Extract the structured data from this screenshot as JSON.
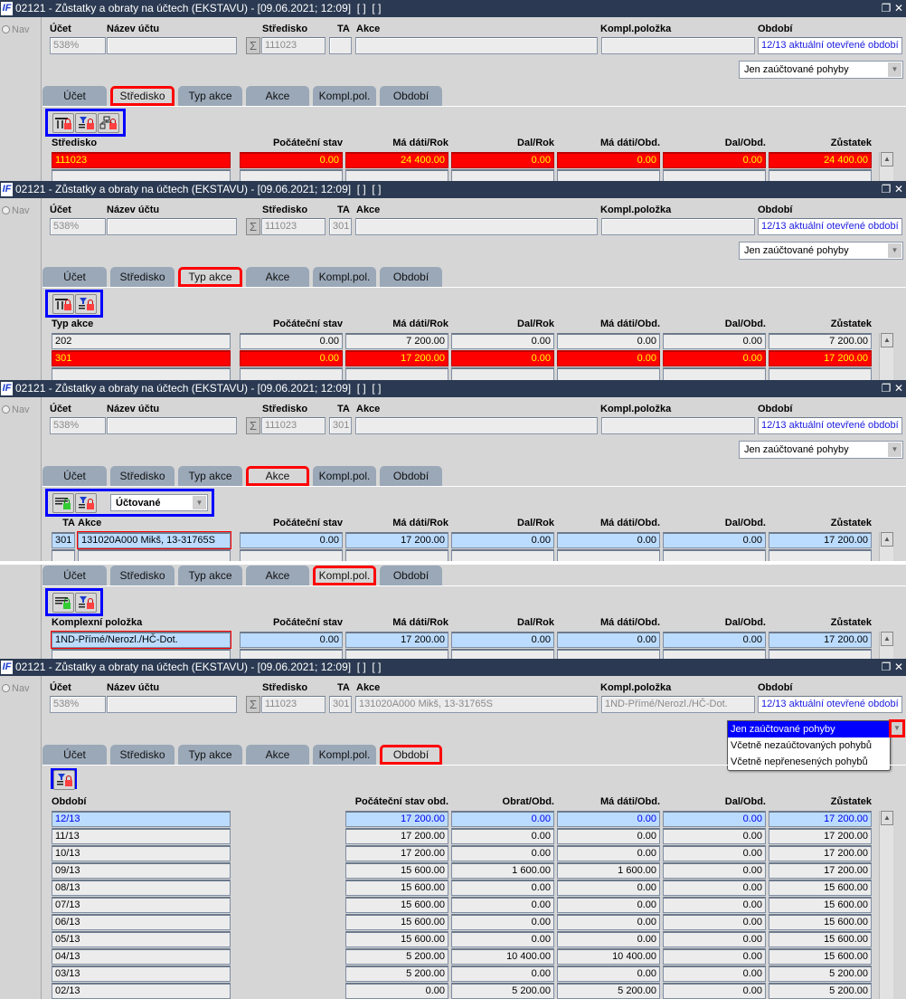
{
  "window": {
    "title": "02121 - Zůstatky a obraty na účtech (EKSTAVU) - [09.06.2021; 12:09]  [ ]  [ ]",
    "nav_label": "Nav",
    "logo": "IF"
  },
  "labels": {
    "ucet": "Účet",
    "nazev": "Název účtu",
    "stredisko": "Středisko",
    "ta": "TA",
    "akce": "Akce",
    "kompl": "Kompl.položka",
    "obdobi": "Období",
    "sigma": "Σ"
  },
  "tabs": [
    "Účet",
    "Středisko",
    "Typ akce",
    "Akce",
    "Kompl.pol.",
    "Období"
  ],
  "filter_options": [
    "Jen zaúčtované pohyby",
    "Včetně nezaúčtovaných pohybů",
    "Včetně nepřenesených pohybů"
  ],
  "colors": {
    "titlebar": "#2b3a52",
    "highlight_red": "#ff0000",
    "toolbar_outline": "#0000ff",
    "selected_row": "#bcdcff"
  },
  "panels": [
    {
      "header": {
        "ucet": "538%",
        "nazev": "",
        "stredisko": "111023",
        "ta": "",
        "akce": "",
        "kompl": "",
        "obdobi": "12/13 aktuální otevřené období"
      },
      "filter": "Jen zaúčtované pohyby",
      "active_tab": 1,
      "toolbar": [
        "columns-lock-icon",
        "filter-lock-icon",
        "hierarchy-lock-icon"
      ],
      "columns": [
        "Středisko",
        "Počáteční stav",
        "Má dáti/Rok",
        "Dal/Rok",
        "Má dáti/Obd.",
        "Dal/Obd.",
        "Zůstatek"
      ],
      "rows": [
        [
          "111023",
          "0.00",
          "24 400.00",
          "0.00",
          "0.00",
          "0.00",
          "24 400.00"
        ]
      ],
      "row_style": "red"
    },
    {
      "header": {
        "ucet": "538%",
        "nazev": "",
        "stredisko": "111023",
        "ta": "301",
        "akce": "",
        "kompl": "",
        "obdobi": "12/13 aktuální otevřené období"
      },
      "filter": "Jen zaúčtované pohyby",
      "active_tab": 2,
      "toolbar": [
        "columns-lock-icon",
        "filter-lock-icon"
      ],
      "columns": [
        "Typ akce",
        "Počáteční stav",
        "Má dáti/Rok",
        "Dal/Rok",
        "Má dáti/Obd.",
        "Dal/Obd.",
        "Zůstatek"
      ],
      "rows": [
        [
          "202",
          "0.00",
          "7 200.00",
          "0.00",
          "0.00",
          "0.00",
          "7 200.00"
        ],
        [
          "301",
          "0.00",
          "17 200.00",
          "0.00",
          "0.00",
          "0.00",
          "17 200.00"
        ]
      ],
      "selected_row": 1,
      "row_style": "red"
    },
    {
      "header": {
        "ucet": "538%",
        "nazev": "",
        "stredisko": "111023",
        "ta": "301",
        "akce": "",
        "kompl": "",
        "obdobi": "12/13 aktuální otevřené období"
      },
      "filter": "Jen zaúčtované pohyby",
      "active_tab": 3,
      "toolbar": [
        "columns-lock-green-icon",
        "filter-lock-icon"
      ],
      "toolbar_select": "Účtované",
      "columns": [
        "TA",
        "Akce",
        "Počáteční stav",
        "Má dáti/Rok",
        "Dal/Rok",
        "Má dáti/Obd.",
        "Dal/Obd.",
        "Zůstatek"
      ],
      "rows": [
        [
          "301",
          "131020A000 Mikš, 13-31765S",
          "0.00",
          "17 200.00",
          "0.00",
          "0.00",
          "0.00",
          "17 200.00"
        ]
      ],
      "row_style": "blue"
    },
    {
      "active_tab": 4,
      "toolbar": [
        "columns-lock-green-icon",
        "filter-lock-icon"
      ],
      "columns": [
        "Komplexní položka",
        "Počáteční stav",
        "Má dáti/Rok",
        "Dal/Rok",
        "Má dáti/Obd.",
        "Dal/Obd.",
        "Zůstatek"
      ],
      "rows": [
        [
          "1ND-Přímé/Nerozl./HČ-Dot.",
          "0.00",
          "17 200.00",
          "0.00",
          "0.00",
          "0.00",
          "17 200.00"
        ]
      ],
      "row_style": "blue"
    },
    {
      "header": {
        "ucet": "538%",
        "nazev": "",
        "stredisko": "111023",
        "ta": "301",
        "akce": "131020A000 Mikš, 13-31765S",
        "kompl": "1ND-Přímé/Nerozl./HČ-Dot.",
        "obdobi": "12/13 aktuální otevřené období"
      },
      "filter": "Jen zaúčtované pohyby",
      "filter_open": true,
      "active_tab": 5,
      "toolbar": [
        "filter-lock-icon"
      ],
      "columns": [
        "Období",
        "Počáteční stav obd.",
        "Obrat/Obd.",
        "Má dáti/Obd.",
        "Dal/Obd.",
        "Zůstatek"
      ],
      "rows": [
        [
          "12/13",
          "17 200.00",
          "0.00",
          "0.00",
          "0.00",
          "17 200.00"
        ],
        [
          "11/13",
          "17 200.00",
          "0.00",
          "0.00",
          "0.00",
          "17 200.00"
        ],
        [
          "10/13",
          "17 200.00",
          "0.00",
          "0.00",
          "0.00",
          "17 200.00"
        ],
        [
          "09/13",
          "15 600.00",
          "1 600.00",
          "1 600.00",
          "0.00",
          "17 200.00"
        ],
        [
          "08/13",
          "15 600.00",
          "0.00",
          "0.00",
          "0.00",
          "15 600.00"
        ],
        [
          "07/13",
          "15 600.00",
          "0.00",
          "0.00",
          "0.00",
          "15 600.00"
        ],
        [
          "06/13",
          "15 600.00",
          "0.00",
          "0.00",
          "0.00",
          "15 600.00"
        ],
        [
          "05/13",
          "15 600.00",
          "0.00",
          "0.00",
          "0.00",
          "15 600.00"
        ],
        [
          "04/13",
          "5 200.00",
          "10 400.00",
          "10 400.00",
          "0.00",
          "15 600.00"
        ],
        [
          "03/13",
          "5 200.00",
          "0.00",
          "0.00",
          "0.00",
          "5 200.00"
        ],
        [
          "02/13",
          "0.00",
          "5 200.00",
          "5 200.00",
          "0.00",
          "5 200.00"
        ]
      ],
      "row_style": "blue-text"
    }
  ]
}
